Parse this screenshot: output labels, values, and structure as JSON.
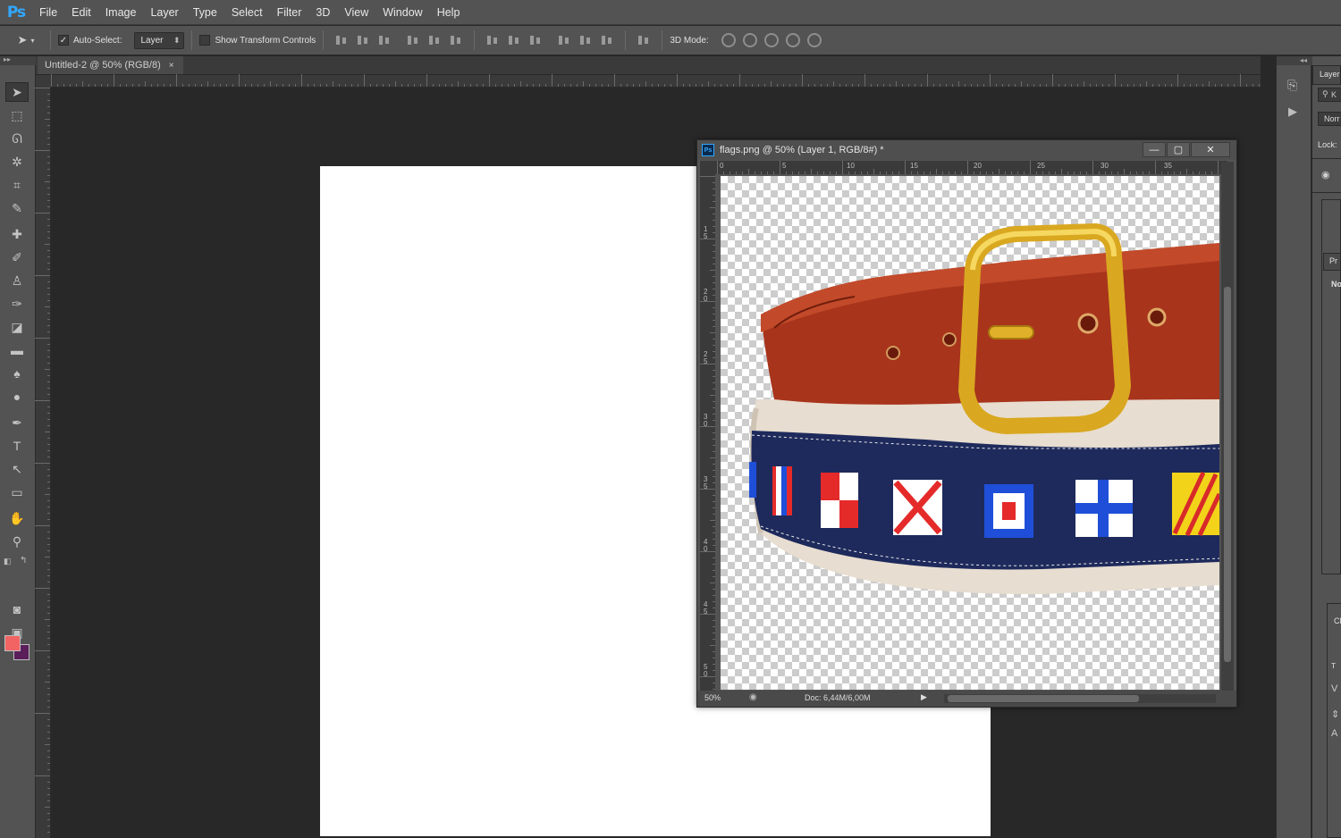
{
  "app": {
    "logo": "Ps"
  },
  "menu": [
    "File",
    "Edit",
    "Image",
    "Layer",
    "Type",
    "Select",
    "Filter",
    "3D",
    "View",
    "Window",
    "Help"
  ],
  "options": {
    "auto_select_label": "Auto-Select:",
    "auto_select_value": "Layer",
    "show_transform_label": "Show Transform Controls",
    "mode3d_label": "3D Mode:"
  },
  "document_tab": {
    "title": "Untitled-2 @ 50% (RGB/8)",
    "close": "×"
  },
  "floating_window": {
    "title": "flags.png @ 50% (Layer 1, RGB/8#) *",
    "icon": "Ps",
    "minimize": "—",
    "maximize": "▢",
    "close": "✕",
    "ruler_top_labels": [
      "0",
      "5",
      "10",
      "15",
      "20",
      "25",
      "30",
      "35"
    ],
    "ruler_left_labels": [
      "1\n5",
      "2\n0",
      "2\n5",
      "3\n0",
      "3\n5",
      "4\n0",
      "4\n5",
      "5\n0"
    ],
    "status": {
      "zoom": "50%",
      "doc_size": "Doc: 6,44M/6,00M"
    }
  },
  "panels": {
    "layers_label": "Layer",
    "search_label": "K",
    "blend_mode": "Norr",
    "lock_label": "Lock:",
    "properties_label": "Pr",
    "properties_sub": "No",
    "char_label": "Cl"
  },
  "colors": {
    "foreground": "#f26464",
    "background": "#5a1e5a",
    "accent": "#31a8ff"
  },
  "image_layer": {
    "description": "leather belt with nautical signal flags"
  }
}
